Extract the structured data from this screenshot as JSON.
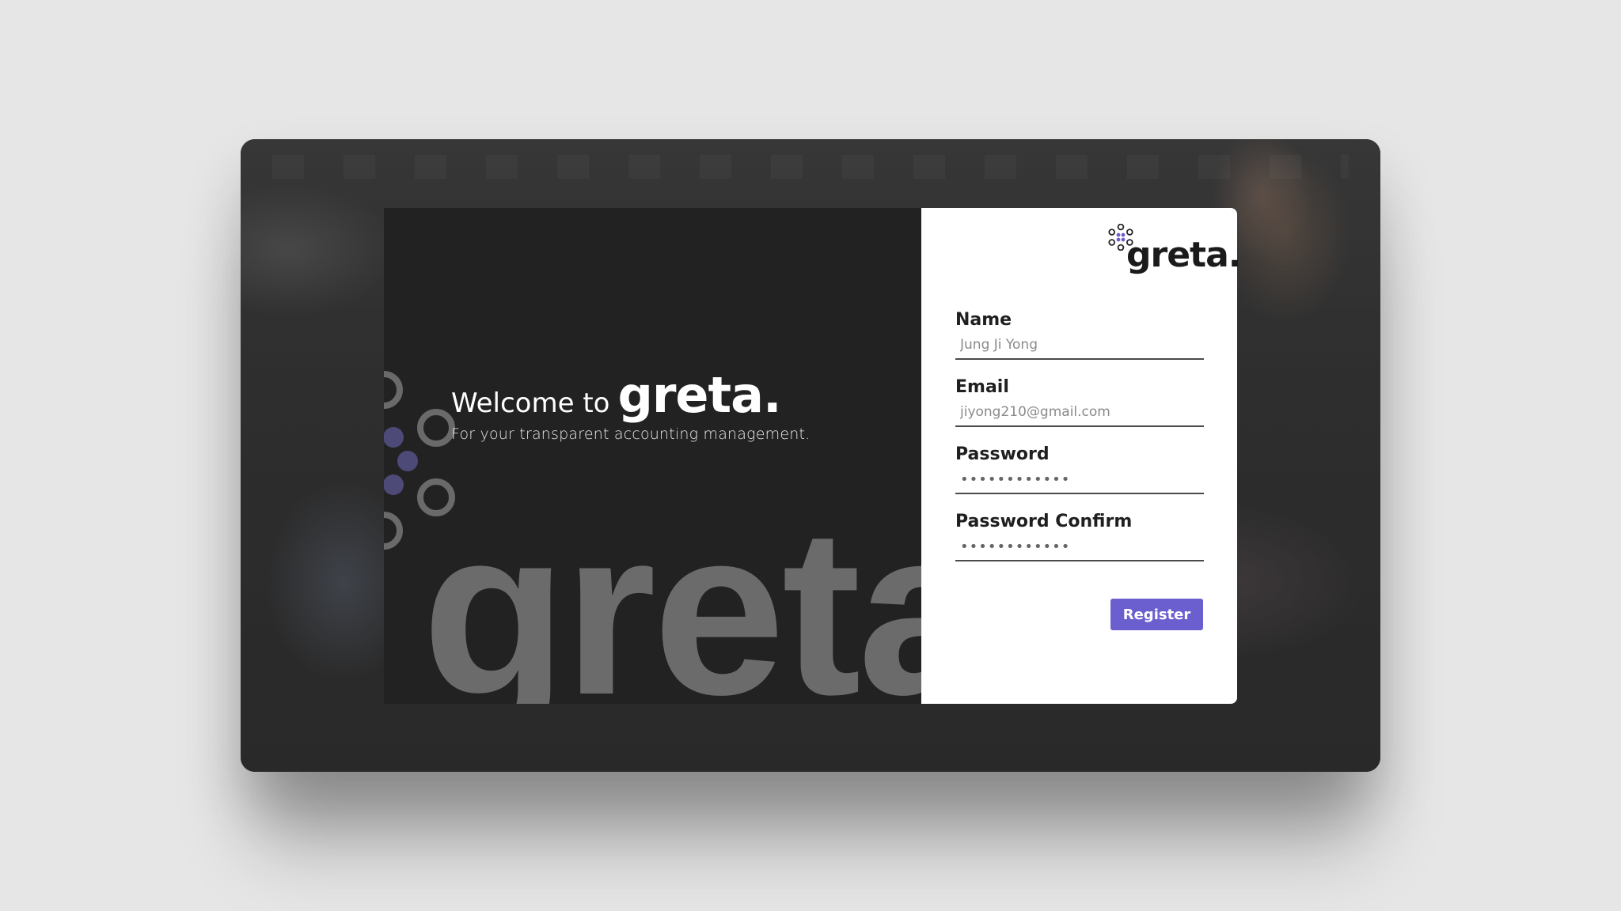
{
  "welcome": {
    "prefix": "Welcome to",
    "brand": "greta.",
    "tagline": "For your transparent accounting management."
  },
  "watermark": "greta",
  "logo": {
    "text": "greta.",
    "icon": "flower-dots-icon"
  },
  "form": {
    "name": {
      "label": "Name",
      "placeholder": "Jung Ji Yong"
    },
    "email": {
      "label": "Email",
      "placeholder": "jiyong210@gmail.com"
    },
    "password": {
      "label": "Password",
      "value": "••••••••••••"
    },
    "password_confirm": {
      "label": "Password Confirm",
      "value": "••••••••••••"
    },
    "register_label": "Register"
  },
  "colors": {
    "accent": "#6b5fd0",
    "panel_dark": "#222222",
    "page_bg": "#e6e6e6"
  }
}
